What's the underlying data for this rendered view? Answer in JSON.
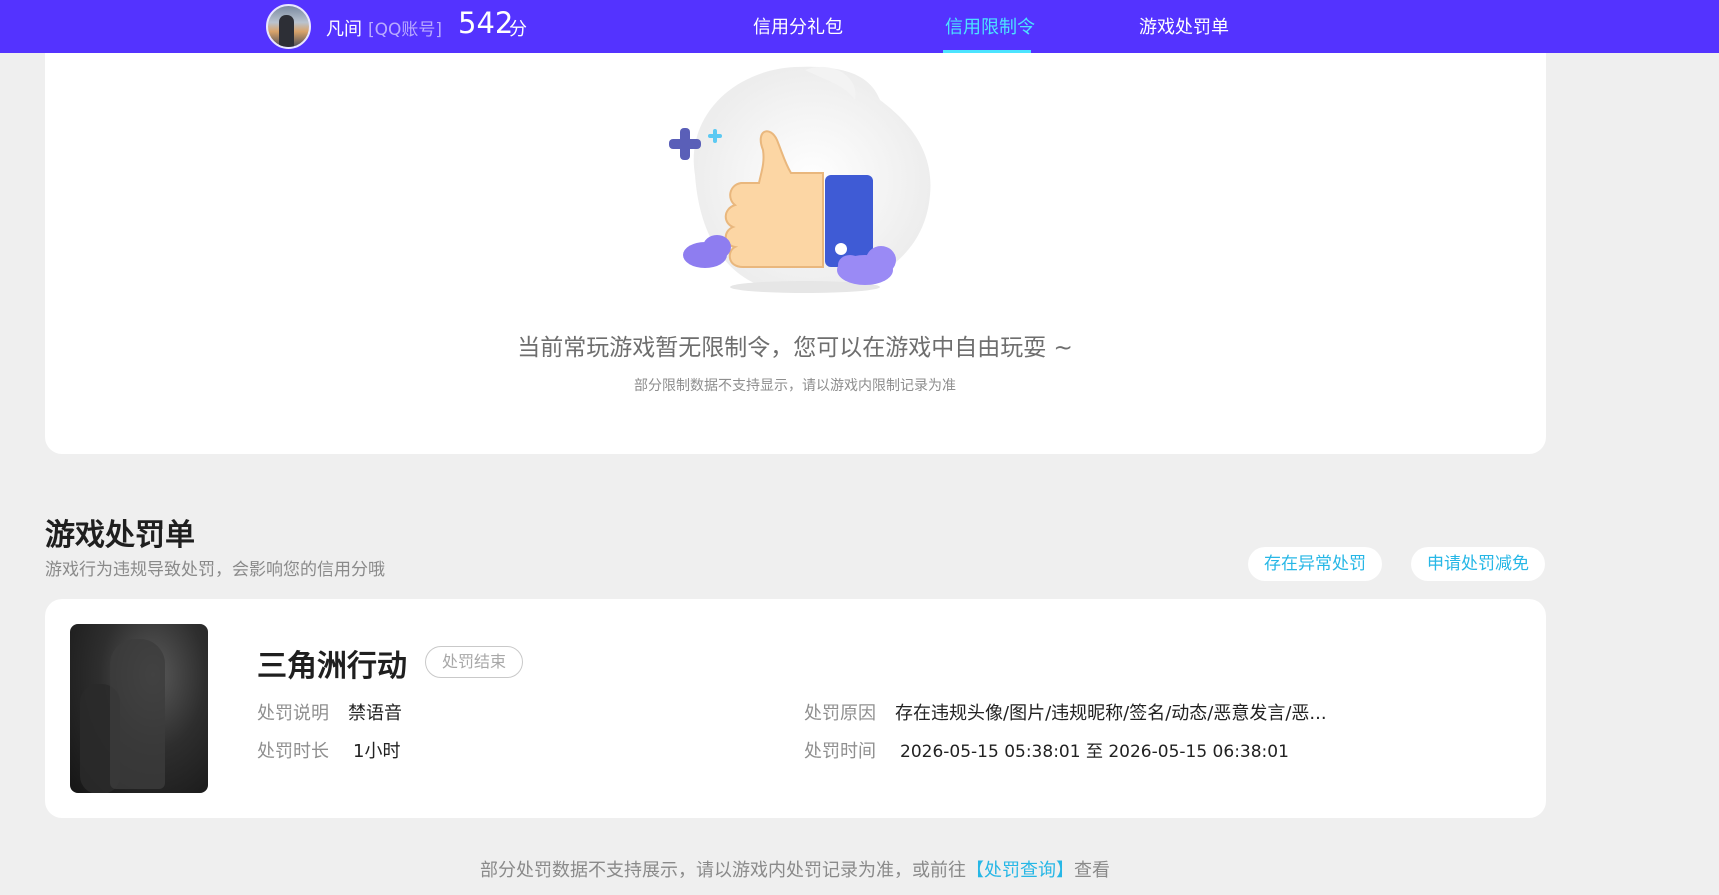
{
  "header": {
    "user_name": "凡间",
    "account_type": "[QQ账号]",
    "score": "542",
    "score_unit": "分",
    "nav": [
      {
        "label": "信用分礼包",
        "active": false
      },
      {
        "label": "信用限制令",
        "active": true
      },
      {
        "label": "游戏处罚单",
        "active": false
      }
    ]
  },
  "restriction": {
    "empty_title": "当前常玩游戏暂无限制令，您可以在游戏中自由玩耍 ~",
    "empty_subtitle": "部分限制数据不支持显示，请以游戏内限制记录为准"
  },
  "penalty_section": {
    "title": "游戏处罚单",
    "description": "游戏行为违规导致处罚，会影响您的信用分哦",
    "buttons": {
      "abnormal": "存在异常处罚",
      "reduce": "申请处罚减免"
    },
    "items": [
      {
        "game": "三角洲行动",
        "status": "处罚结束",
        "desc_label": "处罚说明",
        "desc_value": "禁语音",
        "duration_label": "处罚时长",
        "duration_value": "1小时",
        "reason_label": "处罚原因",
        "reason_value": "存在违规头像/图片/违规昵称/签名/动态/恶意发言/恶...",
        "time_label": "处罚时间",
        "time_value": "2026-05-15 05:38:01 至 2026-05-15 06:38:01"
      }
    ]
  },
  "footer": {
    "note_before": "部分处罚数据不支持展示，请以游戏内处罚记录为准，或前往",
    "link": "【处罚查询】",
    "note_after": "查看"
  },
  "colors": {
    "topbar": "#5433ff",
    "active_nav": "#4ce4ff",
    "link": "#27b7e6",
    "background": "#efefef"
  }
}
